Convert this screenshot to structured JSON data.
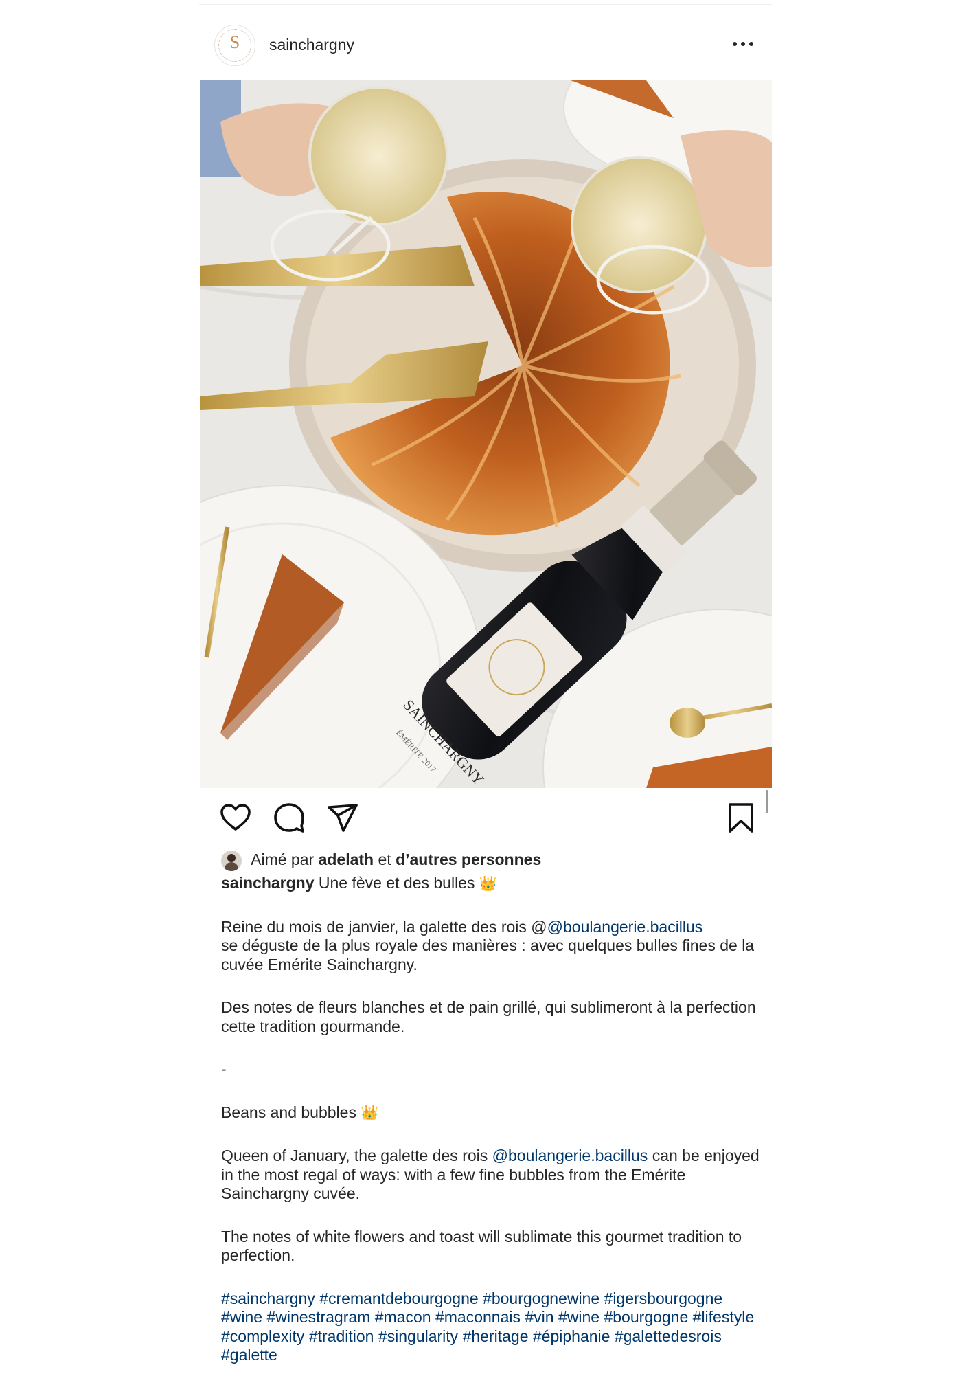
{
  "header": {
    "username": "sainchargny",
    "avatar_letter": "S",
    "more_icon": "more-horizontal-icon"
  },
  "actions": {
    "like_icon": "heart-icon",
    "comment_icon": "comment-icon",
    "share_icon": "send-icon",
    "save_icon": "bookmark-icon"
  },
  "likes": {
    "prefix": "Aimé par",
    "user": "adelath",
    "joiner": "et",
    "others": "d’autres personnes"
  },
  "caption": {
    "author": "sainchargny",
    "title": "Une fève et des bulles",
    "crown_emoji": "👑",
    "fr_p1_a": "Reine du mois de janvier, la galette des rois @",
    "fr_p1_mention": "@boulangerie.bacillus",
    "fr_p1_b": "se déguste de la plus royale des manières : avec quelques bulles fines de la cuvée Emérite Sainchargny.",
    "fr_p2": "Des notes de fleurs blanches et de pain grillé, qui sublimeront à la perfection cette tradition gourmande.",
    "separator": "-",
    "en_title": "Beans and bubbles",
    "en_p1_a": "Queen of January, the galette des rois",
    "en_p1_mention": "@boulangerie.bacillus",
    "en_p1_b": "can be enjoyed in the most regal of ways: with a few fine bubbles from the Emérite Sainchargny cuvée.",
    "en_p2": "The notes of white flowers and toast will sublimate this gourmet tradition to perfection.",
    "hashtags": [
      "#sainchargny",
      "#cremantdebourgogne",
      "#bourgognewine",
      "#igersbourgogne",
      "#wine",
      "#winestragram",
      "#macon",
      "#maconnais",
      "#vin",
      "#wine",
      "#bourgogne",
      "#lifestyle",
      "#complexity",
      "#tradition",
      "#singularity",
      "#heritage",
      "#épiphanie",
      "#galettedesrois",
      "#galette"
    ]
  },
  "photo": {
    "label_brand": "SAINCHARGNY",
    "label_cuvee": "ÉMÉRITE 2017"
  },
  "colors": {
    "link": "#00376b",
    "text": "#262626",
    "pastry": "#c9682a",
    "gold": "#c9a85a"
  }
}
